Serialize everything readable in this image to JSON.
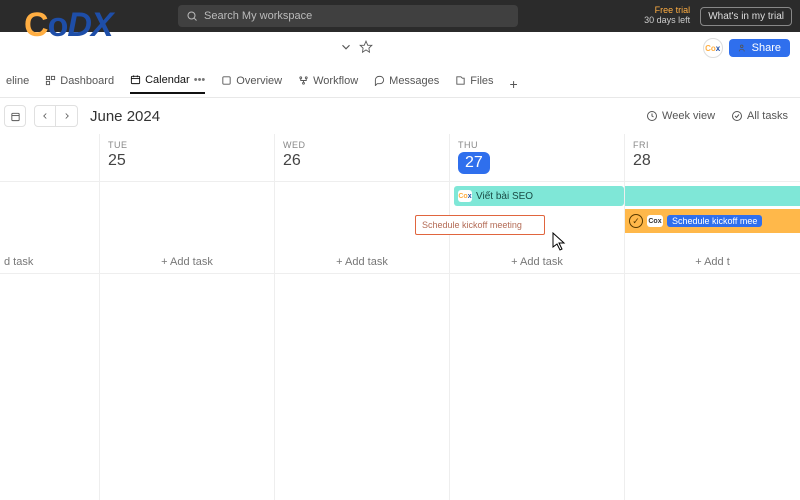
{
  "topbar": {
    "search_placeholder": "Search My workspace",
    "trial_line1": "Free trial",
    "trial_line2": "30 days left",
    "whats_in": "What's in my trial"
  },
  "brand": {
    "c": "C",
    "o": "o",
    "dx": "DX"
  },
  "share": {
    "label": "Share"
  },
  "tabs": {
    "timeline": "eline",
    "dashboard": "Dashboard",
    "calendar": "Calendar",
    "overview": "Overview",
    "workflow": "Workflow",
    "messages": "Messages",
    "files": "Files",
    "more": "•••"
  },
  "controls": {
    "month": "June 2024",
    "week_view": "Week view",
    "all_tasks": "All tasks"
  },
  "columns": [
    {
      "dow": "",
      "num": "",
      "add": "d task"
    },
    {
      "dow": "TUE",
      "num": "25",
      "add": "Add task"
    },
    {
      "dow": "WED",
      "num": "26",
      "add": "Add task"
    },
    {
      "dow": "THU",
      "num": "27",
      "add": "Add task"
    },
    {
      "dow": "FRI",
      "num": "28",
      "add": "Add t"
    }
  ],
  "tasks": {
    "band1": "Viết bài SEO",
    "ghost": "Schedule kickoff meeting",
    "fri_pill": "Schedule kickoff mee"
  }
}
